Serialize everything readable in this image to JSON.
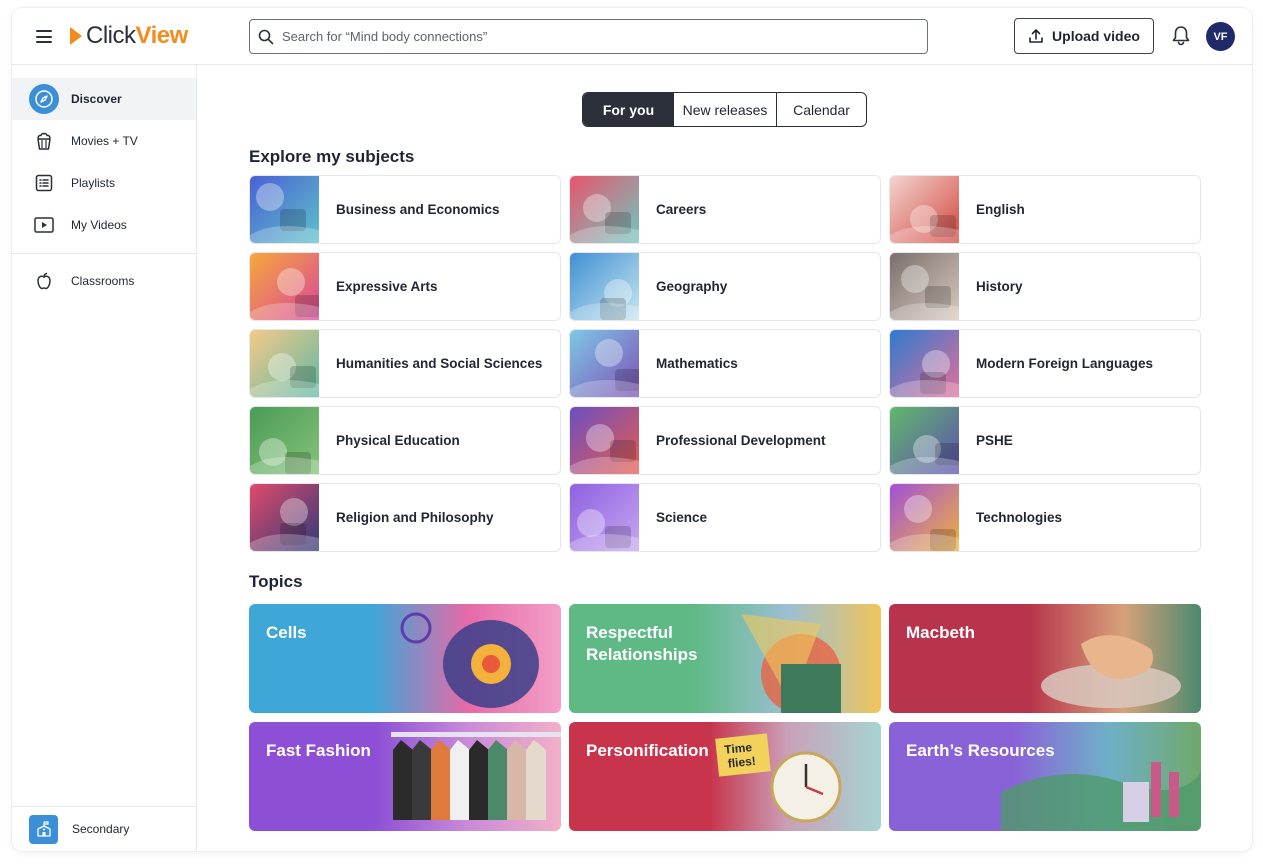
{
  "app": {
    "logo_part1": "Click",
    "logo_part2": "View"
  },
  "header": {
    "search_placeholder": "Search for “Mind body connections”",
    "upload_label": "Upload video",
    "avatar_initials": "VF"
  },
  "sidebar": {
    "items": [
      {
        "label": "Discover",
        "icon": "compass-icon",
        "active": true
      },
      {
        "label": "Movies + TV",
        "icon": "popcorn-icon"
      },
      {
        "label": "Playlists",
        "icon": "list-icon"
      },
      {
        "label": "My Videos",
        "icon": "play-box-icon"
      },
      {
        "label": "Classrooms",
        "icon": "apple-icon"
      }
    ],
    "footer_label": "Secondary"
  },
  "tabs": [
    {
      "label": "For you",
      "active": true
    },
    {
      "label": "New releases"
    },
    {
      "label": "Calendar"
    }
  ],
  "subjects_title": "Explore my subjects",
  "subjects": [
    {
      "label": "Business and Economics",
      "c1": "#4a5fd6",
      "c2": "#5ec3c9"
    },
    {
      "label": "Careers",
      "c1": "#e8546c",
      "c2": "#6fc8c2"
    },
    {
      "label": "English",
      "c1": "#f2d6cf",
      "c2": "#d3463f"
    },
    {
      "label": "Expressive Arts",
      "c1": "#f7a93b",
      "c2": "#d8469a"
    },
    {
      "label": "Geography",
      "c1": "#3f8fd4",
      "c2": "#c9e7ef"
    },
    {
      "label": "History",
      "c1": "#7a6f6a",
      "c2": "#d8cbc0"
    },
    {
      "label": "Humanities and Social Sciences",
      "c1": "#f7c98a",
      "c2": "#5cb9a2"
    },
    {
      "label": "Mathematics",
      "c1": "#7ec8e8",
      "c2": "#7d4fb5"
    },
    {
      "label": "Modern Foreign Languages",
      "c1": "#2c7bd0",
      "c2": "#e56f9a"
    },
    {
      "label": "Physical Education",
      "c1": "#4a9a56",
      "c2": "#86c47a"
    },
    {
      "label": "Professional Development",
      "c1": "#6a4fc2",
      "c2": "#e95c4f"
    },
    {
      "label": "PSHE",
      "c1": "#62b86b",
      "c2": "#5d4fb0"
    },
    {
      "label": "Religion and Philosophy",
      "c1": "#e24b6a",
      "c2": "#2f3a7a"
    },
    {
      "label": "Science",
      "c1": "#8f5fe0",
      "c2": "#c6a8f2"
    },
    {
      "label": "Technologies",
      "c1": "#a14fd8",
      "c2": "#f0b43c"
    }
  ],
  "topics_title": "Topics",
  "topics": [
    {
      "label": "Cells",
      "bg": "linear-gradient(90deg,#3fa6d8 0%,#3fa6d8 40%,#e56aa8 70%,#f3a0c8 100%)"
    },
    {
      "label": "Respectful Relationships",
      "bg": "linear-gradient(90deg,#5fb985 0%,#5fb985 40%,#9bbfd2 70%,#f0c55a 100%)"
    },
    {
      "label": "Macbeth",
      "bg": "linear-gradient(90deg,#b8344c 0%,#b8344c 45%,#d6a17a 75%,#4b8a6e 100%)"
    },
    {
      "label": "Fast Fashion",
      "bg": "linear-gradient(90deg,#8c4fd6 0%,#8c4fd6 40%,#c98ad8 70%,#f2b0c8 100%)"
    },
    {
      "label": "Personification",
      "bg": "linear-gradient(90deg,#c8344c 0%,#c8344c 45%,#c9a0b8 70%,#a6d4d2 100%)"
    },
    {
      "label": "Earth’s Resources",
      "bg": "linear-gradient(90deg,#8a62d8 0%,#8a62d8 40%,#6fb0c8 70%,#6fa86a 100%)"
    }
  ],
  "topic_art_text": "Time flies!"
}
